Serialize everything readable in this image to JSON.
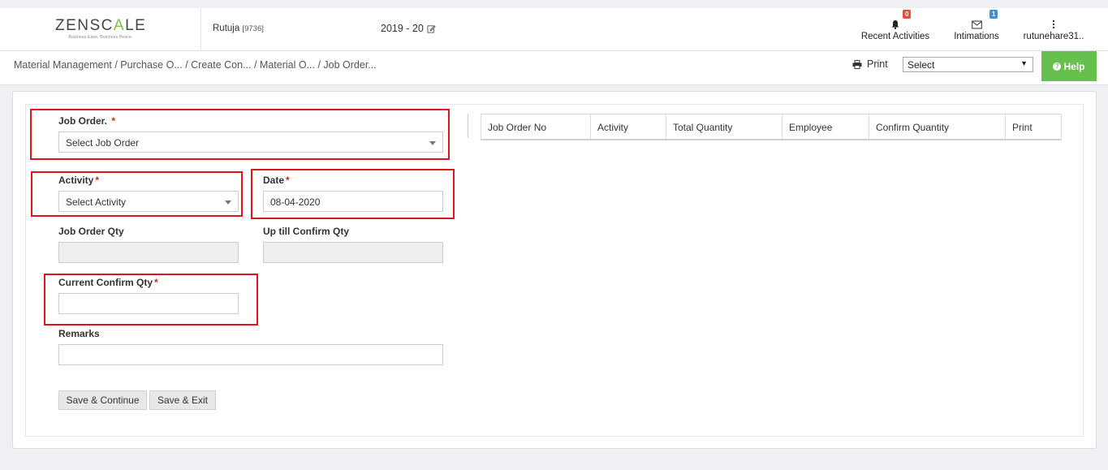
{
  "header": {
    "logo_text_a": "ZENSC",
    "logo_text_b": "A",
    "logo_text_c": "LE",
    "logo_tagline": "Business Ease, Business Peace.",
    "user": "Rutuja",
    "user_id": "[9736]",
    "fiscal_year": "2019 - 20",
    "recent_activities_label": "Recent Activities",
    "recent_activities_count": "0",
    "intimations_label": "Intimations",
    "intimations_count": "1",
    "account_label": "rutunehare31.."
  },
  "breadcrumb": {
    "text": "Material Management   / Purchase O... / Create Con... / Material O... / Job Order..."
  },
  "toolbar": {
    "print_label": "Print",
    "select_value": "Select",
    "help_label": "Help"
  },
  "form": {
    "job_order_label": "Job Order.",
    "job_order_value": "Select Job Order",
    "activity_label": "Activity",
    "activity_value": "Select Activity",
    "date_label": "Date",
    "date_value": "08-04-2020",
    "job_order_qty_label": "Job Order Qty",
    "up_till_label": "Up till Confirm Qty",
    "current_confirm_label": "Current Confirm Qty",
    "remarks_label": "Remarks",
    "required_mark": "*"
  },
  "actions": {
    "save_continue": "Save & Continue",
    "save_exit": "Save & Exit"
  },
  "table": {
    "columns": [
      "Job Order No",
      "Activity",
      "Total Quantity",
      "Employee",
      "Confirm Quantity",
      "Print"
    ]
  },
  "colors": {
    "accent_green": "#66c04d",
    "highlight_red": "#e0141b",
    "badge_red": "#e74c3c",
    "badge_blue": "#3b8fd6"
  }
}
